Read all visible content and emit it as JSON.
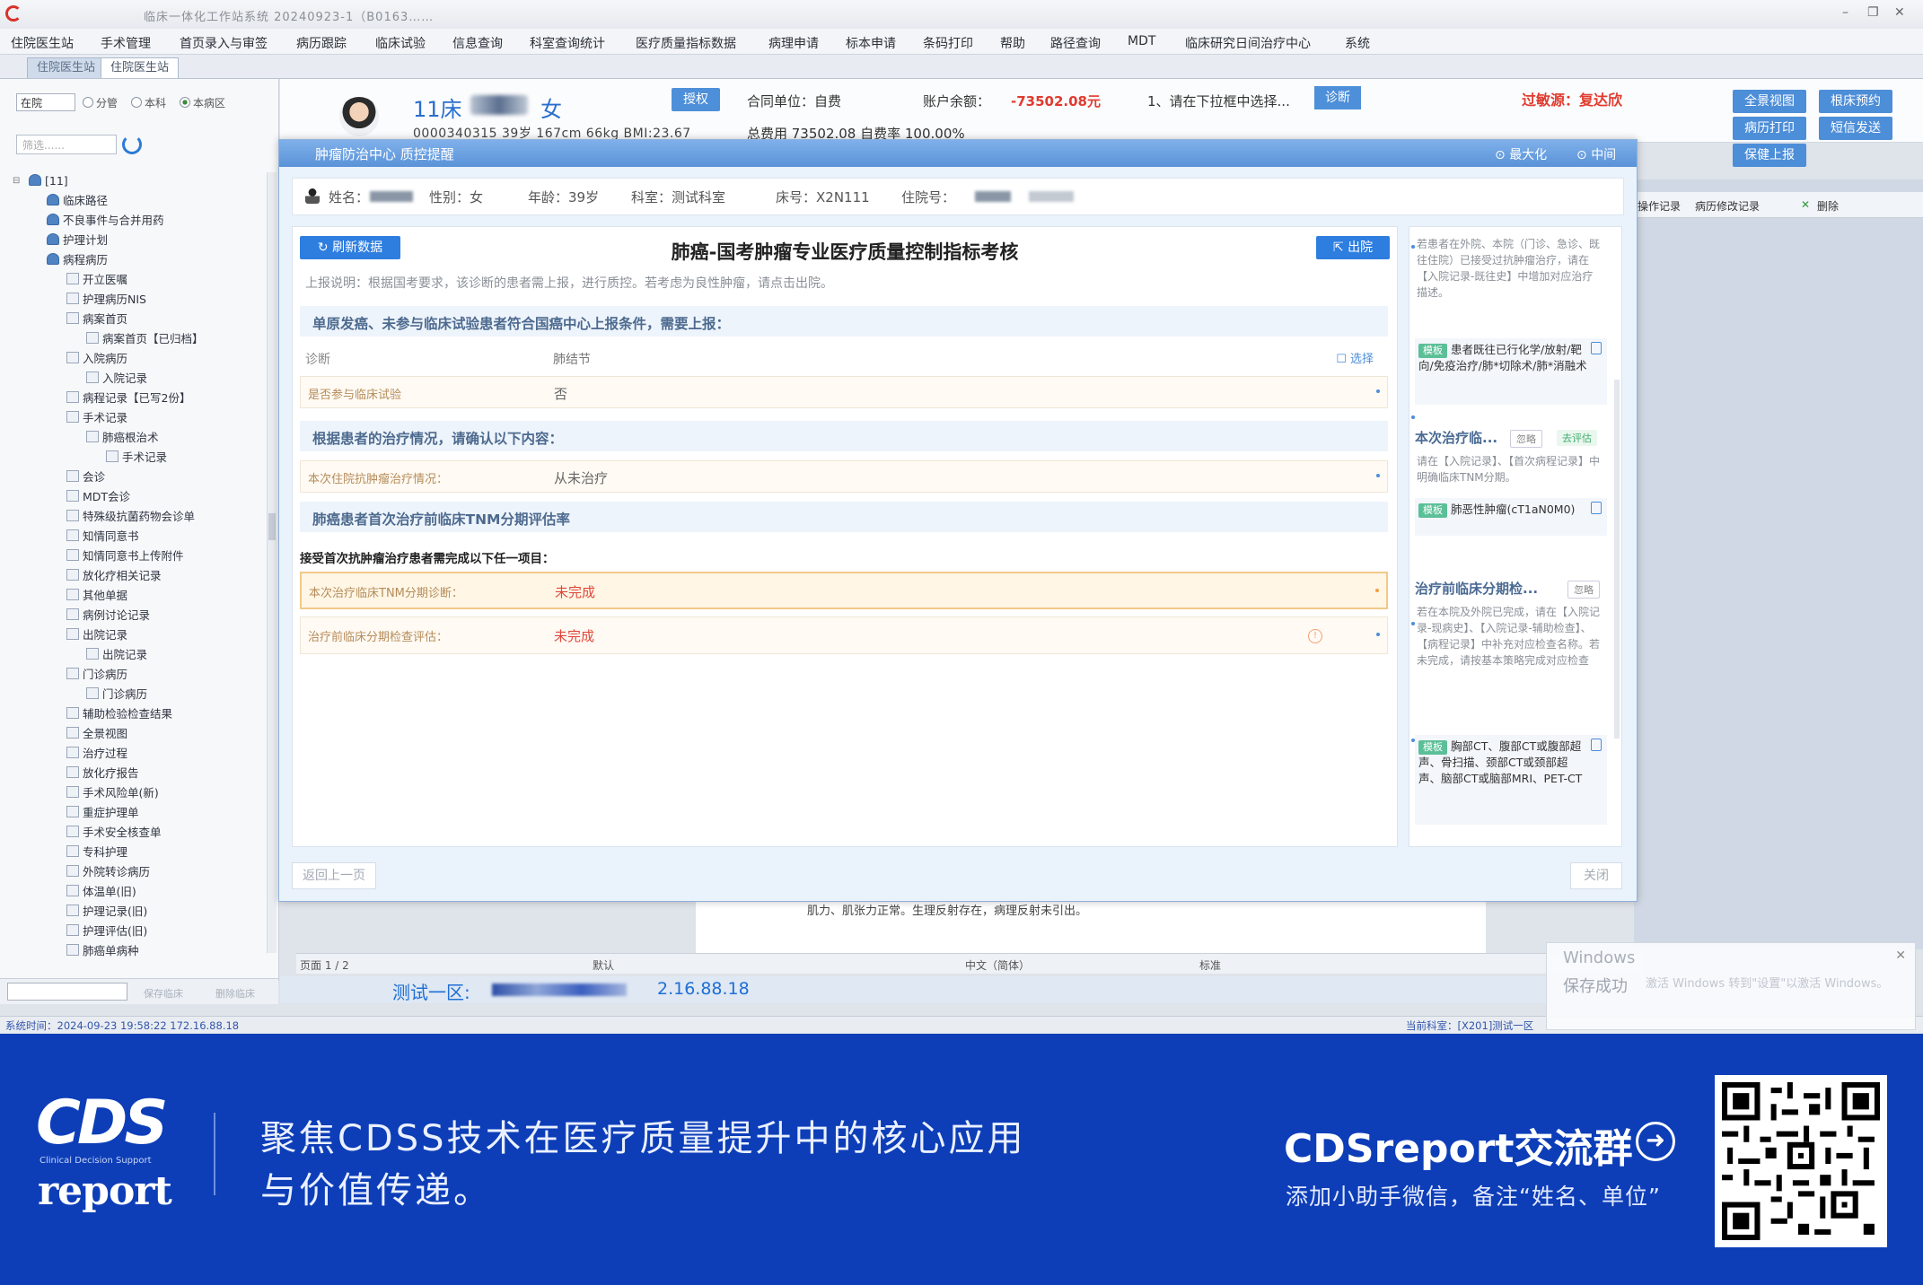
{
  "window": {
    "title": "临床一体化工作站系统 20240923-1（B0163……",
    "controls": [
      "–",
      "❐",
      "✕"
    ]
  },
  "menu": [
    "住院医生站",
    "手术管理",
    "首页录入与审签",
    "病历跟踪",
    "临床试验",
    "信息查询",
    "科室查询统计",
    "医疗质量指标数据",
    "病理申请",
    "标本申请",
    "条码打印",
    "帮助",
    "路径查询",
    "MDT",
    "临床研究日间治疗中心",
    "系统"
  ],
  "tabs": [
    "住院医生站",
    "住院医生站"
  ],
  "left_panel": {
    "scope_value": "在院",
    "radios": [
      "分管",
      "本科",
      "本病区"
    ],
    "filter_placeholder": "筛选......",
    "tree": [
      "[11]",
      "临床路径",
      "不良事件与合并用药",
      "护理计划",
      "病程病历",
      "开立医嘱",
      "护理病历NIS",
      "病案首页",
      "病案首页【已归档】",
      "入院病历",
      "入院记录",
      "病程记录【已写2份】",
      "手术记录",
      "肺癌根治术",
      "手术记录",
      "会诊",
      "MDT会诊",
      "特殊级抗菌药物会诊单",
      "知情同意书",
      "知情同意书上传附件",
      "放化疗相关记录",
      "其他单据",
      "病例讨论记录",
      "出院记录",
      "出院记录",
      "门诊病历",
      "门诊病历",
      "辅助检验检查结果",
      "全景视图",
      "治疗过程",
      "放化疗报告",
      "手术风险单(新)",
      "重症护理单",
      "手术安全核查单",
      "专科护理",
      "外院转诊病历",
      "体温单(旧)",
      "护理记录(旧)",
      "护理评估(旧)",
      "肺癌单病种"
    ],
    "bottom_labels": [
      "保存临床",
      "删除临床"
    ]
  },
  "patient": {
    "bed": "11床",
    "gender": "女",
    "id_line": "0000340315 39岁 167cm 66kg BMI:23.67",
    "auth_button": "授权",
    "contract": "合同单位：自费",
    "balance_label": "账户余额：",
    "balance_value": "-73502.08元",
    "total_fee": "总费用 73502.08 自费率 100.00%",
    "prompt": "1、请在下拉框中选择...",
    "diag_button": "诊断",
    "allergy": "过敏源：复达欣",
    "right_buttons": [
      "全景视图",
      "根床预约",
      "病历打印",
      "短信发送",
      "保健上报"
    ]
  },
  "behind_toolbar": [
    "操作记录",
    "病历修改记录",
    "删除"
  ],
  "doc_behind_text": "肌力、肌张力正常。生理反射存在，病理反射未引出。",
  "page_strip": [
    "页面 1 / 2",
    "默认",
    "中文（简体）",
    "标准"
  ],
  "zone": {
    "title": "测试一区:",
    "ip": "2.16.88.18"
  },
  "status_bar": {
    "left": "系统时间：2024-09-23 19:58:22  172.16.88.18",
    "right": "当前科室：[X201]测试一区"
  },
  "toast": {
    "title": "Windows",
    "body": "保存成功",
    "watermark": "激活 Windows 转到\"设置\"以激活 Windows。"
  },
  "modal": {
    "title": "肿瘤防治中心 质控提醒",
    "maximize": "最大化",
    "center": "中间",
    "patient_bar": {
      "name_label": "姓名：",
      "sex": "性别：女",
      "age": "年龄：39岁",
      "dept": "科室：测试科室",
      "bed": "床号：X2N111",
      "admission": "住院号："
    },
    "refresh_button": "刷新数据",
    "export_button": "出院",
    "card_title": "肺癌-国考肿瘤专业医疗质量控制指标考核",
    "note": "上报说明：根据国考要求，该诊断的患者需上报，进行质控。若考虑为良性肿瘤，请点击出院。",
    "section1": "单原发癌、未参与临床试验患者符合国癌中心上报条件，需要上报：",
    "diag_label": "诊断",
    "diag_value": "肺结节",
    "diag_action": "选择",
    "trial_label": "是否参与临床试验",
    "trial_value": "否",
    "section2": "根据患者的治疗情况，请确认以下内容：",
    "treatment_label": "本次住院抗肿瘤治疗情况：",
    "treatment_value": "从未治疗",
    "section3": "肺癌患者首次治疗前临床TNM分期评估率",
    "subhead": "接受首次抗肿瘤治疗患者需完成以下任一项目：",
    "tnm_label": "本次治疗临床TNM分期诊断：",
    "tnm_value": "未完成",
    "eval_label": "治疗前临床分期检查评估：",
    "eval_value": "未完成",
    "back_button": "返回上一页",
    "close_button": "关闭",
    "side": {
      "block1": "若患者在外院、本院（门诊、急诊、既往住院）已接受过抗肿瘤治疗，请在【入院记录-既往史】中增加对应治疗描述。",
      "hint1_tag": "模板",
      "hint1": "患者既往已行化学/放射/靶向/免疫治疗/肺*切除术/肺*消融术",
      "hdr2": "本次治疗临...",
      "hdr2_a": "忽略",
      "hdr2_b": "去评估",
      "block2": "请在【入院记录】、【首次病程记录】中明确临床TNM分期。",
      "hint2_tag": "模板",
      "hint2": "肺恶性肿瘤(cT1aN0M0)",
      "hdr3": "治疗前临床分期检...",
      "hdr3_a": "忽略",
      "block3": "若在本院及外院已完成，请在【入院记录-现病史】、【入院记录-辅助检查】、【病程记录】中补充对应检查名称。若未完成，请按基本策略完成对应检查",
      "hint3_tag": "模板",
      "hint3": "胸部CT、腹部CT或腹部超声、骨扫描、颈部CT或颈部超声、脑部CT或脑部MRI、PET-CT"
    }
  },
  "banner": {
    "logo_big": "CDS",
    "logo_small": "Clinical Decision Support",
    "logo_report": "report",
    "line1": "聚焦CDSS技术在医疗质量提升中的核心应用",
    "line2": "与价值传递。",
    "group": "CDSreport交流群",
    "add": "添加小助手微信，备注“姓名、单位”"
  },
  "colors": {
    "accent": "#2e7ee0",
    "danger": "#e03b2f",
    "banner": "#0d3eb8",
    "modal_header": "#5a93d8"
  }
}
